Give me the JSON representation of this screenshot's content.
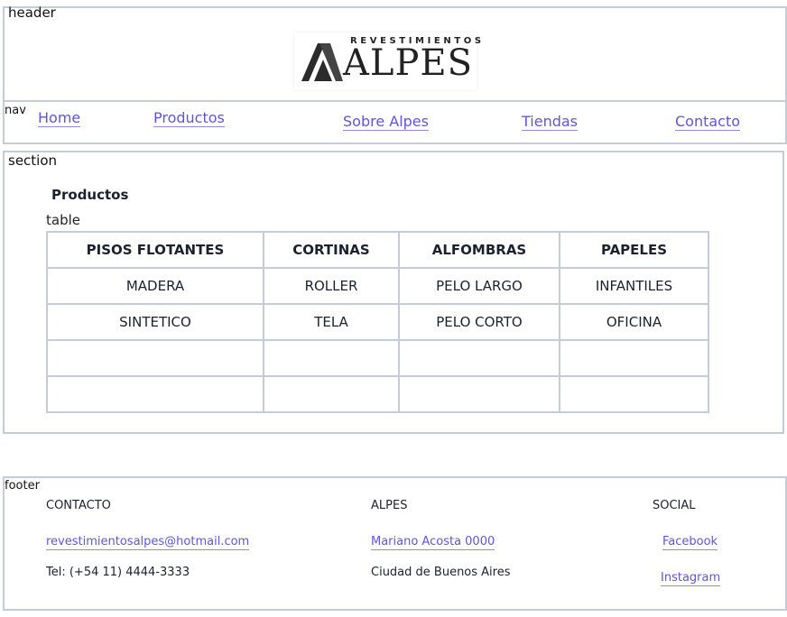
{
  "header": {
    "tag": "header",
    "logo": {
      "top_text": "REVESTIMIENTOS",
      "main_text": "ALPES"
    }
  },
  "nav": {
    "tag": "nav",
    "links": [
      "Home",
      "Productos",
      "Sobre Alpes",
      "Tiendas",
      "Contacto"
    ]
  },
  "section": {
    "tag": "section",
    "title": "Productos",
    "table_tag": "table",
    "table": {
      "headers": [
        "PISOS FLOTANTES",
        "CORTINAS",
        "ALFOMBRAS",
        "PAPELES"
      ],
      "rows": [
        [
          "MADERA",
          "ROLLER",
          "PELO LARGO",
          "INFANTILES"
        ],
        [
          "SINTETICO",
          "TELA",
          "PELO CORTO",
          "OFICINA"
        ],
        [
          "",
          "",
          "",
          ""
        ],
        [
          "",
          "",
          "",
          ""
        ]
      ]
    }
  },
  "footer": {
    "tag": "footer",
    "contacto": {
      "heading": "CONTACTO",
      "email": "revestimientosalpes@hotmail.com",
      "tel": "Tel: (+54 11) 4444-3333"
    },
    "alpes": {
      "heading": "ALPES",
      "address": "Mariano Acosta 0000",
      "city": "Ciudad de Buenos Aires"
    },
    "social": {
      "heading": "SOCIAL",
      "facebook": "Facebook",
      "instagram": "Instagram"
    }
  },
  "colors": {
    "link": "#5f54e6",
    "border": "#c5ccd8",
    "text": "#1c2130"
  }
}
